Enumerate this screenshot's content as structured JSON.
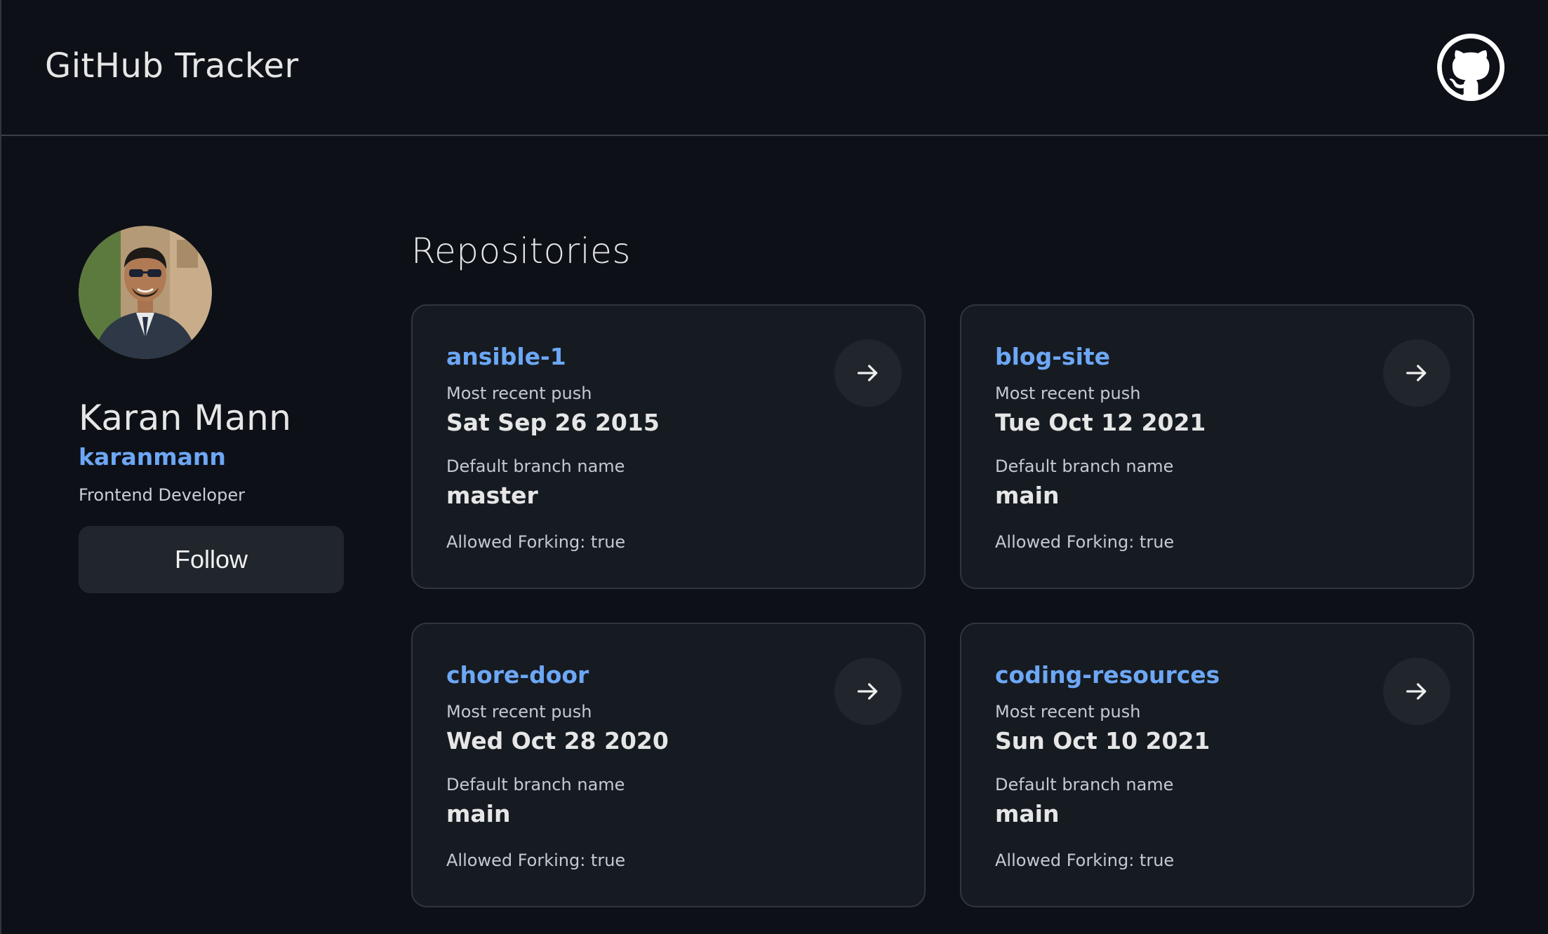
{
  "header": {
    "title": "GitHub Tracker",
    "logo_icon": "github-octocat-icon"
  },
  "profile": {
    "name": "Karan Mann",
    "login": "karanmann",
    "bio": "Frontend Developer",
    "follow_label": "Follow"
  },
  "repos": {
    "heading": "Repositories",
    "items": [
      {
        "name": "ansible-1",
        "push_label": "Most recent push",
        "push_date": "Sat Sep 26 2015",
        "branch_label": "Default branch name",
        "branch": "master",
        "forking": "Allowed Forking: true"
      },
      {
        "name": "blog-site",
        "push_label": "Most recent push",
        "push_date": "Tue Oct 12 2021",
        "branch_label": "Default branch name",
        "branch": "main",
        "forking": "Allowed Forking: true"
      },
      {
        "name": "chore-door",
        "push_label": "Most recent push",
        "push_date": "Wed Oct 28 2020",
        "branch_label": "Default branch name",
        "branch": "main",
        "forking": "Allowed Forking: true"
      },
      {
        "name": "coding-resources",
        "push_label": "Most recent push",
        "push_date": "Sun Oct 10 2021",
        "branch_label": "Default branch name",
        "branch": "main",
        "forking": "Allowed Forking: true"
      }
    ]
  },
  "colors": {
    "background": "#0d1117",
    "card": "#161b22",
    "accent": "#6da7f5",
    "button": "#21262d"
  }
}
